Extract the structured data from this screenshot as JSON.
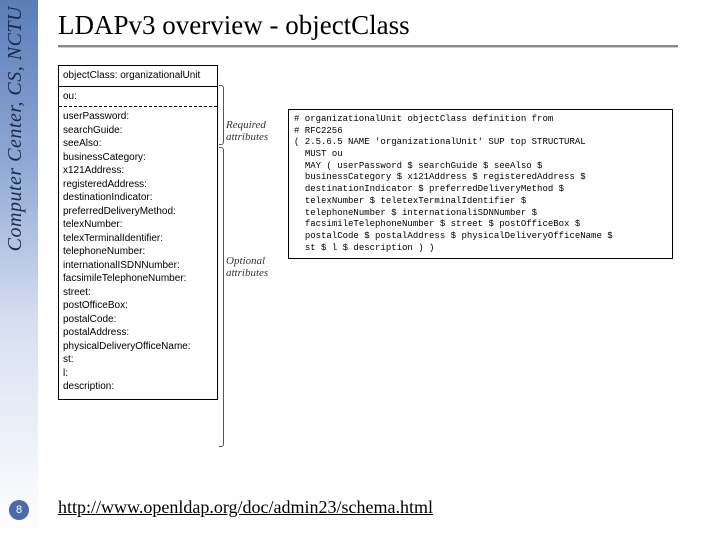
{
  "sidebar": {
    "org_text": "Computer Center, CS, NCTU",
    "page_number": "8"
  },
  "title": "LDAPv3 overview - objectClass",
  "diagram": {
    "box_header": "objectClass: organizationalUnit",
    "must_attr": "ou:",
    "required_label": "Required\nattributes",
    "optional_label": "Optional\nattributes",
    "optional_attrs": [
      "userPassword:",
      "searchGuide:",
      "seeAlso:",
      "businessCategory:",
      "x121Address:",
      "registeredAddress:",
      "destinationIndicator:",
      "preferredDeliveryMethod:",
      "telexNumber:",
      "telexTerminalIdentifier:",
      "telephoneNumber:",
      "internationalISDNNumber:",
      "facsimileTelephoneNumber:",
      "street:",
      "postOfficeBox:",
      "postalCode:",
      "postalAddress:",
      "physicalDeliveryOfficeName:",
      "st:",
      "l:",
      "description:"
    ],
    "code_lines": [
      "# organizationalUnit objectClass definition from",
      "# RFC2256",
      "( 2.5.6.5 NAME 'organizationalUnit' SUP top STRUCTURAL",
      "  MUST ou",
      "  MAY ( userPassword $ searchGuide $ seeAlso $",
      "  businessCategory $ x121Address $ registeredAddress $",
      "  destinationIndicator $ preferredDeliveryMethod $",
      "  telexNumber $ teletexTerminalIdentifier $",
      "  telephoneNumber $ internationaliSDNNumber $",
      "  facsimileTelephoneNumber $ street $ postOfficeBox $",
      "  postalCode $ postalAddress $ physicalDeliveryOfficeName $",
      "  st $ l $ description ) )"
    ]
  },
  "footer_url": "http://www.openldap.org/doc/admin23/schema.html"
}
